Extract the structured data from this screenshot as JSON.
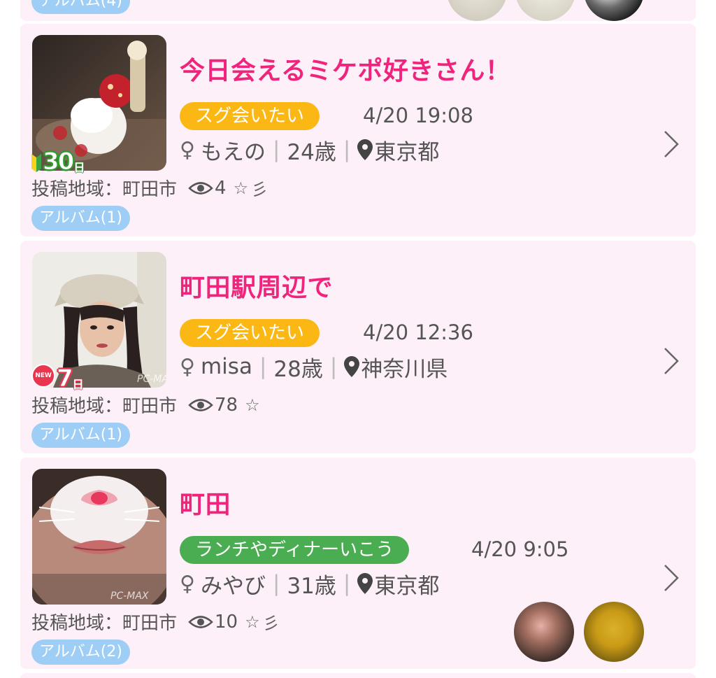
{
  "prev_card": {
    "album_label": "アルバム(4)"
  },
  "posts": [
    {
      "title": "今日会えるミケポ好きさん！",
      "tag": "スグ会いたい",
      "tag_color": "#fbb814",
      "date": "4/20 19:08",
      "gender_icon": "female-icon",
      "name": "もえの",
      "age": "24歳",
      "location": "東京都",
      "area": "投稿地域：町田市",
      "views": "4",
      "star": "☆",
      "extra_icon": "彡",
      "album_label": "アルバム(1)",
      "badge": {
        "type": "newbie",
        "number": "30",
        "unit": "日"
      }
    },
    {
      "title": "町田駅周辺で",
      "tag": "スグ会いたい",
      "tag_color": "#fbb814",
      "date": "4/20 12:36",
      "gender_icon": "female-icon",
      "name": "misa",
      "age": "28歳",
      "location": "神奈川県",
      "area": "投稿地域：町田市",
      "views": "78",
      "star": "☆",
      "album_label": "アルバム(1)",
      "badge": {
        "type": "new",
        "label": "NEW",
        "number": "7",
        "unit": "日"
      },
      "watermark": "PC-MAX"
    },
    {
      "title": "町田",
      "tag": "ランチやディナーいこう",
      "tag_color": "#4bad52",
      "date": "4/20 9:05",
      "gender_icon": "female-icon",
      "name": "みやび",
      "age": "31歳",
      "location": "東京都",
      "area": "投稿地域：町田市",
      "views": "10",
      "star": "☆",
      "extra_icon": "彡",
      "album_label": "アルバム(2)",
      "watermark": "PC-MAX"
    }
  ],
  "colors": {
    "title": "#f0247c",
    "card_bg": "#fdf0f8",
    "album_badge": "#9ecdf5",
    "text": "#555555"
  }
}
